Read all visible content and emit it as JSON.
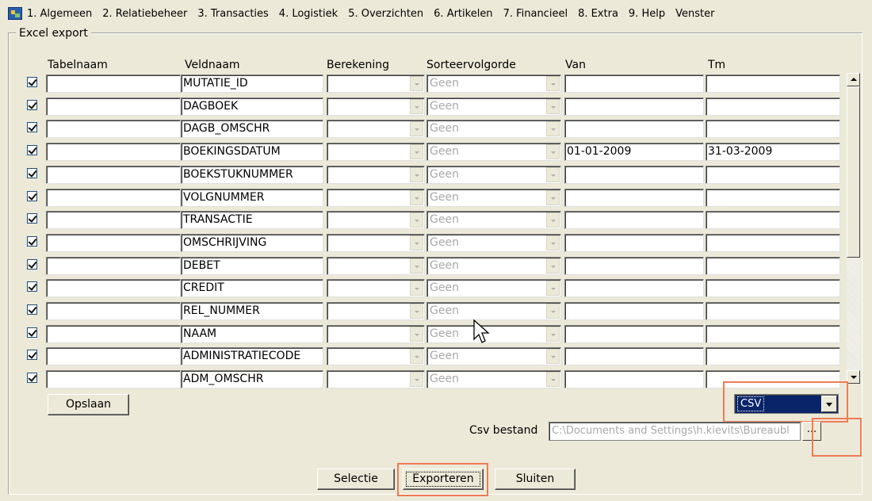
{
  "menu": {
    "items": [
      "1. Algemeen",
      "2. Relatiebeheer",
      "3. Transacties",
      "4. Logistiek",
      "5. Overzichten",
      "6. Artikelen",
      "7. Financieel",
      "8. Extra",
      "9. Help",
      "Venster"
    ]
  },
  "group_title": "Excel export",
  "columns": {
    "tabelnaam": "Tabelnaam",
    "veldnaam": "Veldnaam",
    "berekening": "Berekening",
    "sorteervolgorde": "Sorteervolgorde",
    "van": "Van",
    "tm": "Tm"
  },
  "rows": [
    {
      "checked": true,
      "tabelnaam": "",
      "veldnaam": "MUTATIE_ID",
      "berekening": "",
      "sortering": "Geen",
      "van": "",
      "tm": ""
    },
    {
      "checked": true,
      "tabelnaam": "",
      "veldnaam": "DAGBOEK",
      "berekening": "",
      "sortering": "Geen",
      "van": "",
      "tm": ""
    },
    {
      "checked": true,
      "tabelnaam": "",
      "veldnaam": "DAGB_OMSCHR",
      "berekening": "",
      "sortering": "Geen",
      "van": "",
      "tm": ""
    },
    {
      "checked": true,
      "tabelnaam": "",
      "veldnaam": "BOEKINGSDATUM",
      "berekening": "",
      "sortering": "Geen",
      "van": "01-01-2009",
      "tm": "31-03-2009"
    },
    {
      "checked": true,
      "tabelnaam": "",
      "veldnaam": "BOEKSTUKNUMMER",
      "berekening": "",
      "sortering": "Geen",
      "van": "",
      "tm": ""
    },
    {
      "checked": true,
      "tabelnaam": "",
      "veldnaam": "VOLGNUMMER",
      "berekening": "",
      "sortering": "Geen",
      "van": "",
      "tm": ""
    },
    {
      "checked": true,
      "tabelnaam": "",
      "veldnaam": "TRANSACTIE",
      "berekening": "",
      "sortering": "Geen",
      "van": "",
      "tm": ""
    },
    {
      "checked": true,
      "tabelnaam": "",
      "veldnaam": "OMSCHRIJVING",
      "berekening": "",
      "sortering": "Geen",
      "van": "",
      "tm": ""
    },
    {
      "checked": true,
      "tabelnaam": "",
      "veldnaam": "DEBET",
      "berekening": "",
      "sortering": "Geen",
      "van": "",
      "tm": ""
    },
    {
      "checked": true,
      "tabelnaam": "",
      "veldnaam": "CREDIT",
      "berekening": "",
      "sortering": "Geen",
      "van": "",
      "tm": ""
    },
    {
      "checked": true,
      "tabelnaam": "",
      "veldnaam": "REL_NUMMER",
      "berekening": "",
      "sortering": "Geen",
      "van": "",
      "tm": ""
    },
    {
      "checked": true,
      "tabelnaam": "",
      "veldnaam": "NAAM",
      "berekening": "",
      "sortering": "Geen",
      "van": "",
      "tm": ""
    },
    {
      "checked": true,
      "tabelnaam": "",
      "veldnaam": "ADMINISTRATIECODE",
      "berekening": "",
      "sortering": "Geen",
      "van": "",
      "tm": ""
    },
    {
      "checked": true,
      "tabelnaam": "",
      "veldnaam": "ADM_OMSCHR",
      "berekening": "",
      "sortering": "Geen",
      "van": "",
      "tm": ""
    }
  ],
  "buttons": {
    "opslaan": "Opslaan",
    "selectie": "Selectie",
    "exporteren": "Exporteren",
    "sluiten": "Sluiten"
  },
  "export_format": {
    "selected": "CSV"
  },
  "csv": {
    "label": "Csv bestand",
    "path": "C:\\Documents and Settings\\h.kievits\\Bureaubl",
    "browse_label": "..."
  },
  "colors": {
    "highlight": "#f07b54",
    "selection": "#0a246a",
    "window_bg": "#ece9d8"
  }
}
